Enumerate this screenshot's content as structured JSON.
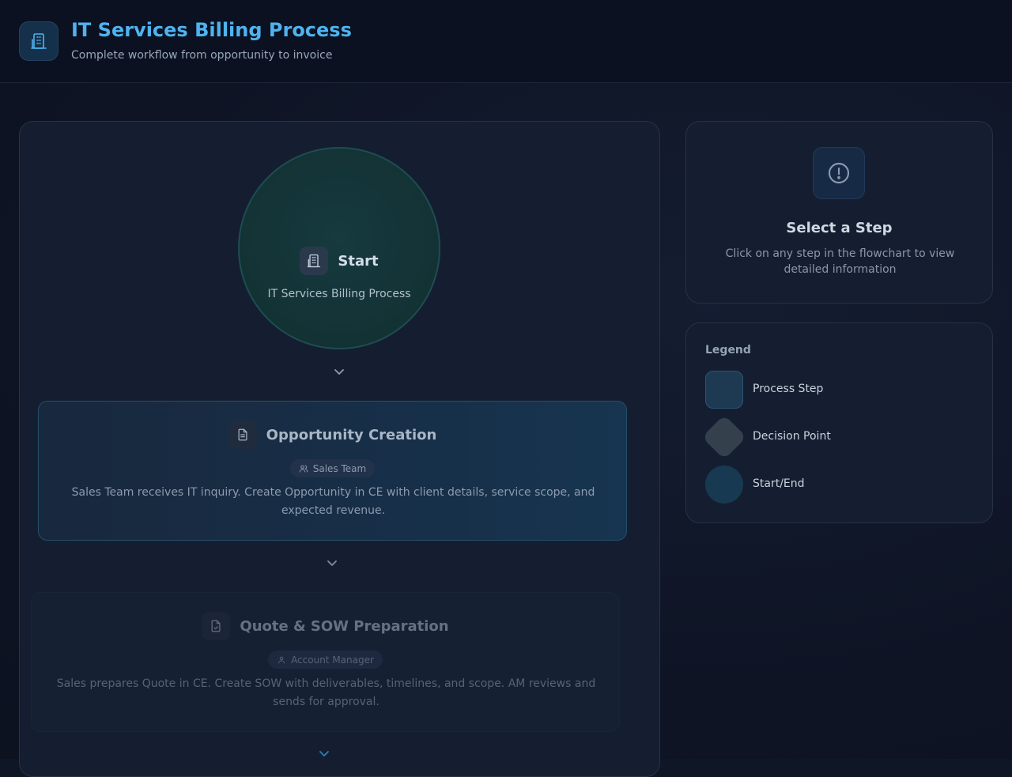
{
  "header": {
    "title": "IT Services Billing Process",
    "subtitle": "Complete workflow from opportunity to invoice",
    "logo_icon": "building-icon"
  },
  "flowchart": {
    "start": {
      "title": "Start",
      "subtitle": "IT Services Billing Process",
      "icon": "building-icon"
    },
    "steps": [
      {
        "title": "Opportunity Creation",
        "role": "Sales Team",
        "description": "Sales Team receives IT inquiry. Create Opportunity in CE with client details, service scope, and expected revenue.",
        "icon": "document-icon",
        "role_icon": "users-icon"
      },
      {
        "title": "Quote & SOW Preparation",
        "role": "Account Manager",
        "description": "Sales prepares Quote in CE. Create SOW with deliverables, timelines, and scope. AM reviews and sends for approval.",
        "icon": "file-check-icon",
        "role_icon": "user-icon"
      }
    ]
  },
  "details": {
    "title": "Select a Step",
    "text": "Click on any step in the flowchart to view detailed information",
    "icon": "alert-circle-icon"
  },
  "legend": {
    "title": "Legend",
    "items": [
      {
        "label": "Process Step",
        "shape": "rounded-square"
      },
      {
        "label": "Decision Point",
        "shape": "diamond"
      },
      {
        "label": "Start/End",
        "shape": "circle"
      }
    ]
  },
  "colors": {
    "accent": "#4fb3ee",
    "background": "#0f1626",
    "panel": "#151e30",
    "start_fill": "#143436"
  }
}
